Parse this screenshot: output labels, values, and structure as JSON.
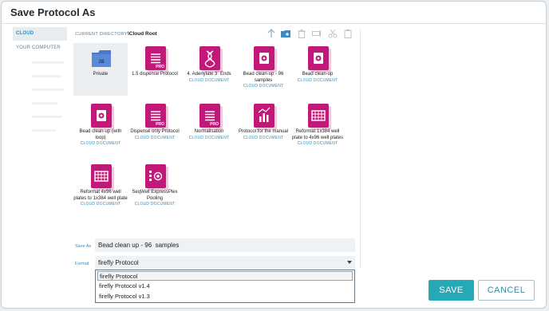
{
  "dialog": {
    "title": "Save Protocol As"
  },
  "sidebar": {
    "items": [
      {
        "label": "CLOUD",
        "active": true
      },
      {
        "label": "YOUR COMPUTER",
        "active": false
      }
    ]
  },
  "directory": {
    "label": "CURRENT DIRECTORY:",
    "path": "\\Cloud Root"
  },
  "toolbar": {
    "icons": [
      "up-arrow-icon",
      "new-folder-icon",
      "trash-icon",
      "rename-icon",
      "cut-icon",
      "paste-icon"
    ]
  },
  "files": [
    {
      "name": "Private",
      "type": "folder",
      "folder_tag": "JB",
      "subtitle": ""
    },
    {
      "name": "1.5 dispense Protocol",
      "type": "pro",
      "subtitle": ""
    },
    {
      "name": "4. Adenylate 3` Ends",
      "type": "dna",
      "subtitle": "CLOUD DOCUMENT"
    },
    {
      "name": "Bead clean-up - 96 samples",
      "type": "bead",
      "subtitle": "CLOUD DOCUMENT"
    },
    {
      "name": "Bead clean-up",
      "type": "bead",
      "subtitle": "CLOUD DOCUMENT"
    },
    {
      "name": "Bead clean-up (with loop)",
      "type": "bead",
      "subtitle": "CLOUD DOCUMENT"
    },
    {
      "name": "Dispense only Protocol",
      "type": "pro",
      "subtitle": "CLOUD DOCUMENT"
    },
    {
      "name": "Normalisation",
      "type": "pro",
      "subtitle": "CLOUD DOCUMENT"
    },
    {
      "name": "Protocol for the manual",
      "type": "chart",
      "subtitle": "CLOUD DOCUMENT"
    },
    {
      "name": "Reformat 1x384 well plate to 4x96 well plates",
      "type": "plate",
      "subtitle": "CLOUD DOCUMENT"
    },
    {
      "name": "Reformat 4x96 well plates to 1x384 well plate",
      "type": "plate",
      "subtitle": "CLOUD DOCUMENT"
    },
    {
      "name": "SeqWell ExpressPlex Pooling",
      "type": "seq",
      "subtitle": "CLOUD DOCUMENT"
    }
  ],
  "save": {
    "saveas_label": "Save As",
    "filename": "Bead clean up - 96  samples",
    "format_label": "Format",
    "format_value": "firefly Protocol",
    "format_options": [
      "firefly Protocol",
      "firefly Protocol v1.4",
      "firefly Protocol v1.3"
    ]
  },
  "buttons": {
    "save": "SAVE",
    "cancel": "CANCEL"
  },
  "colors": {
    "accent": "#26a9b6",
    "doc": "#c2187a",
    "folder": "#5b7fd0",
    "link": "#2f8fc0"
  }
}
